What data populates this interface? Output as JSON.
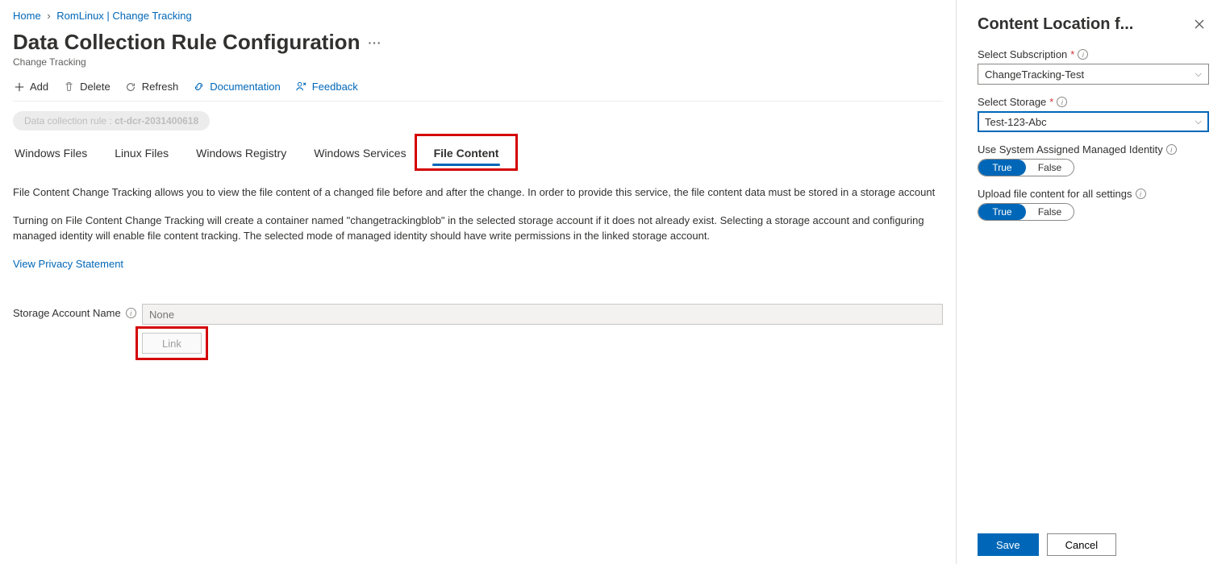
{
  "breadcrumb": {
    "home": "Home",
    "item2": "RomLinux | Change Tracking"
  },
  "page": {
    "title": "Data Collection Rule Configuration",
    "subtitle": "Change Tracking"
  },
  "toolbar": {
    "add": "Add",
    "delete": "Delete",
    "refresh": "Refresh",
    "documentation": "Documentation",
    "feedback": "Feedback"
  },
  "pill": {
    "prefix": "Data collection rule : ",
    "value": "ct-dcr-2031400618"
  },
  "tabs": {
    "t1": "Windows Files",
    "t2": "Linux Files",
    "t3": "Windows Registry",
    "t4": "Windows Services",
    "t5": "File Content"
  },
  "desc": {
    "p1": "File Content Change Tracking allows you to view the file content of a changed file before and after the change. In order to provide this service, the file content data must be stored in a storage account",
    "p2": "Turning on File Content Change Tracking will create a container named \"changetrackingblob\" in the selected storage account if it does not already exist. Selecting a storage account and configuring managed identity will enable file content tracking. The selected mode of managed identity should have write permissions in the linked storage account.",
    "privacy": "View Privacy Statement"
  },
  "storage": {
    "label": "Storage Account Name",
    "placeholder": "None",
    "link_btn": "Link"
  },
  "panel": {
    "title": "Content Location f...",
    "subscription_label": "Select Subscription",
    "subscription_value": "ChangeTracking-Test",
    "storage_label": "Select Storage",
    "storage_value": "Test-123-Abc",
    "identity_label": "Use System Assigned Managed Identity",
    "upload_label": "Upload file content for all settings",
    "true": "True",
    "false": "False",
    "save": "Save",
    "cancel": "Cancel"
  }
}
